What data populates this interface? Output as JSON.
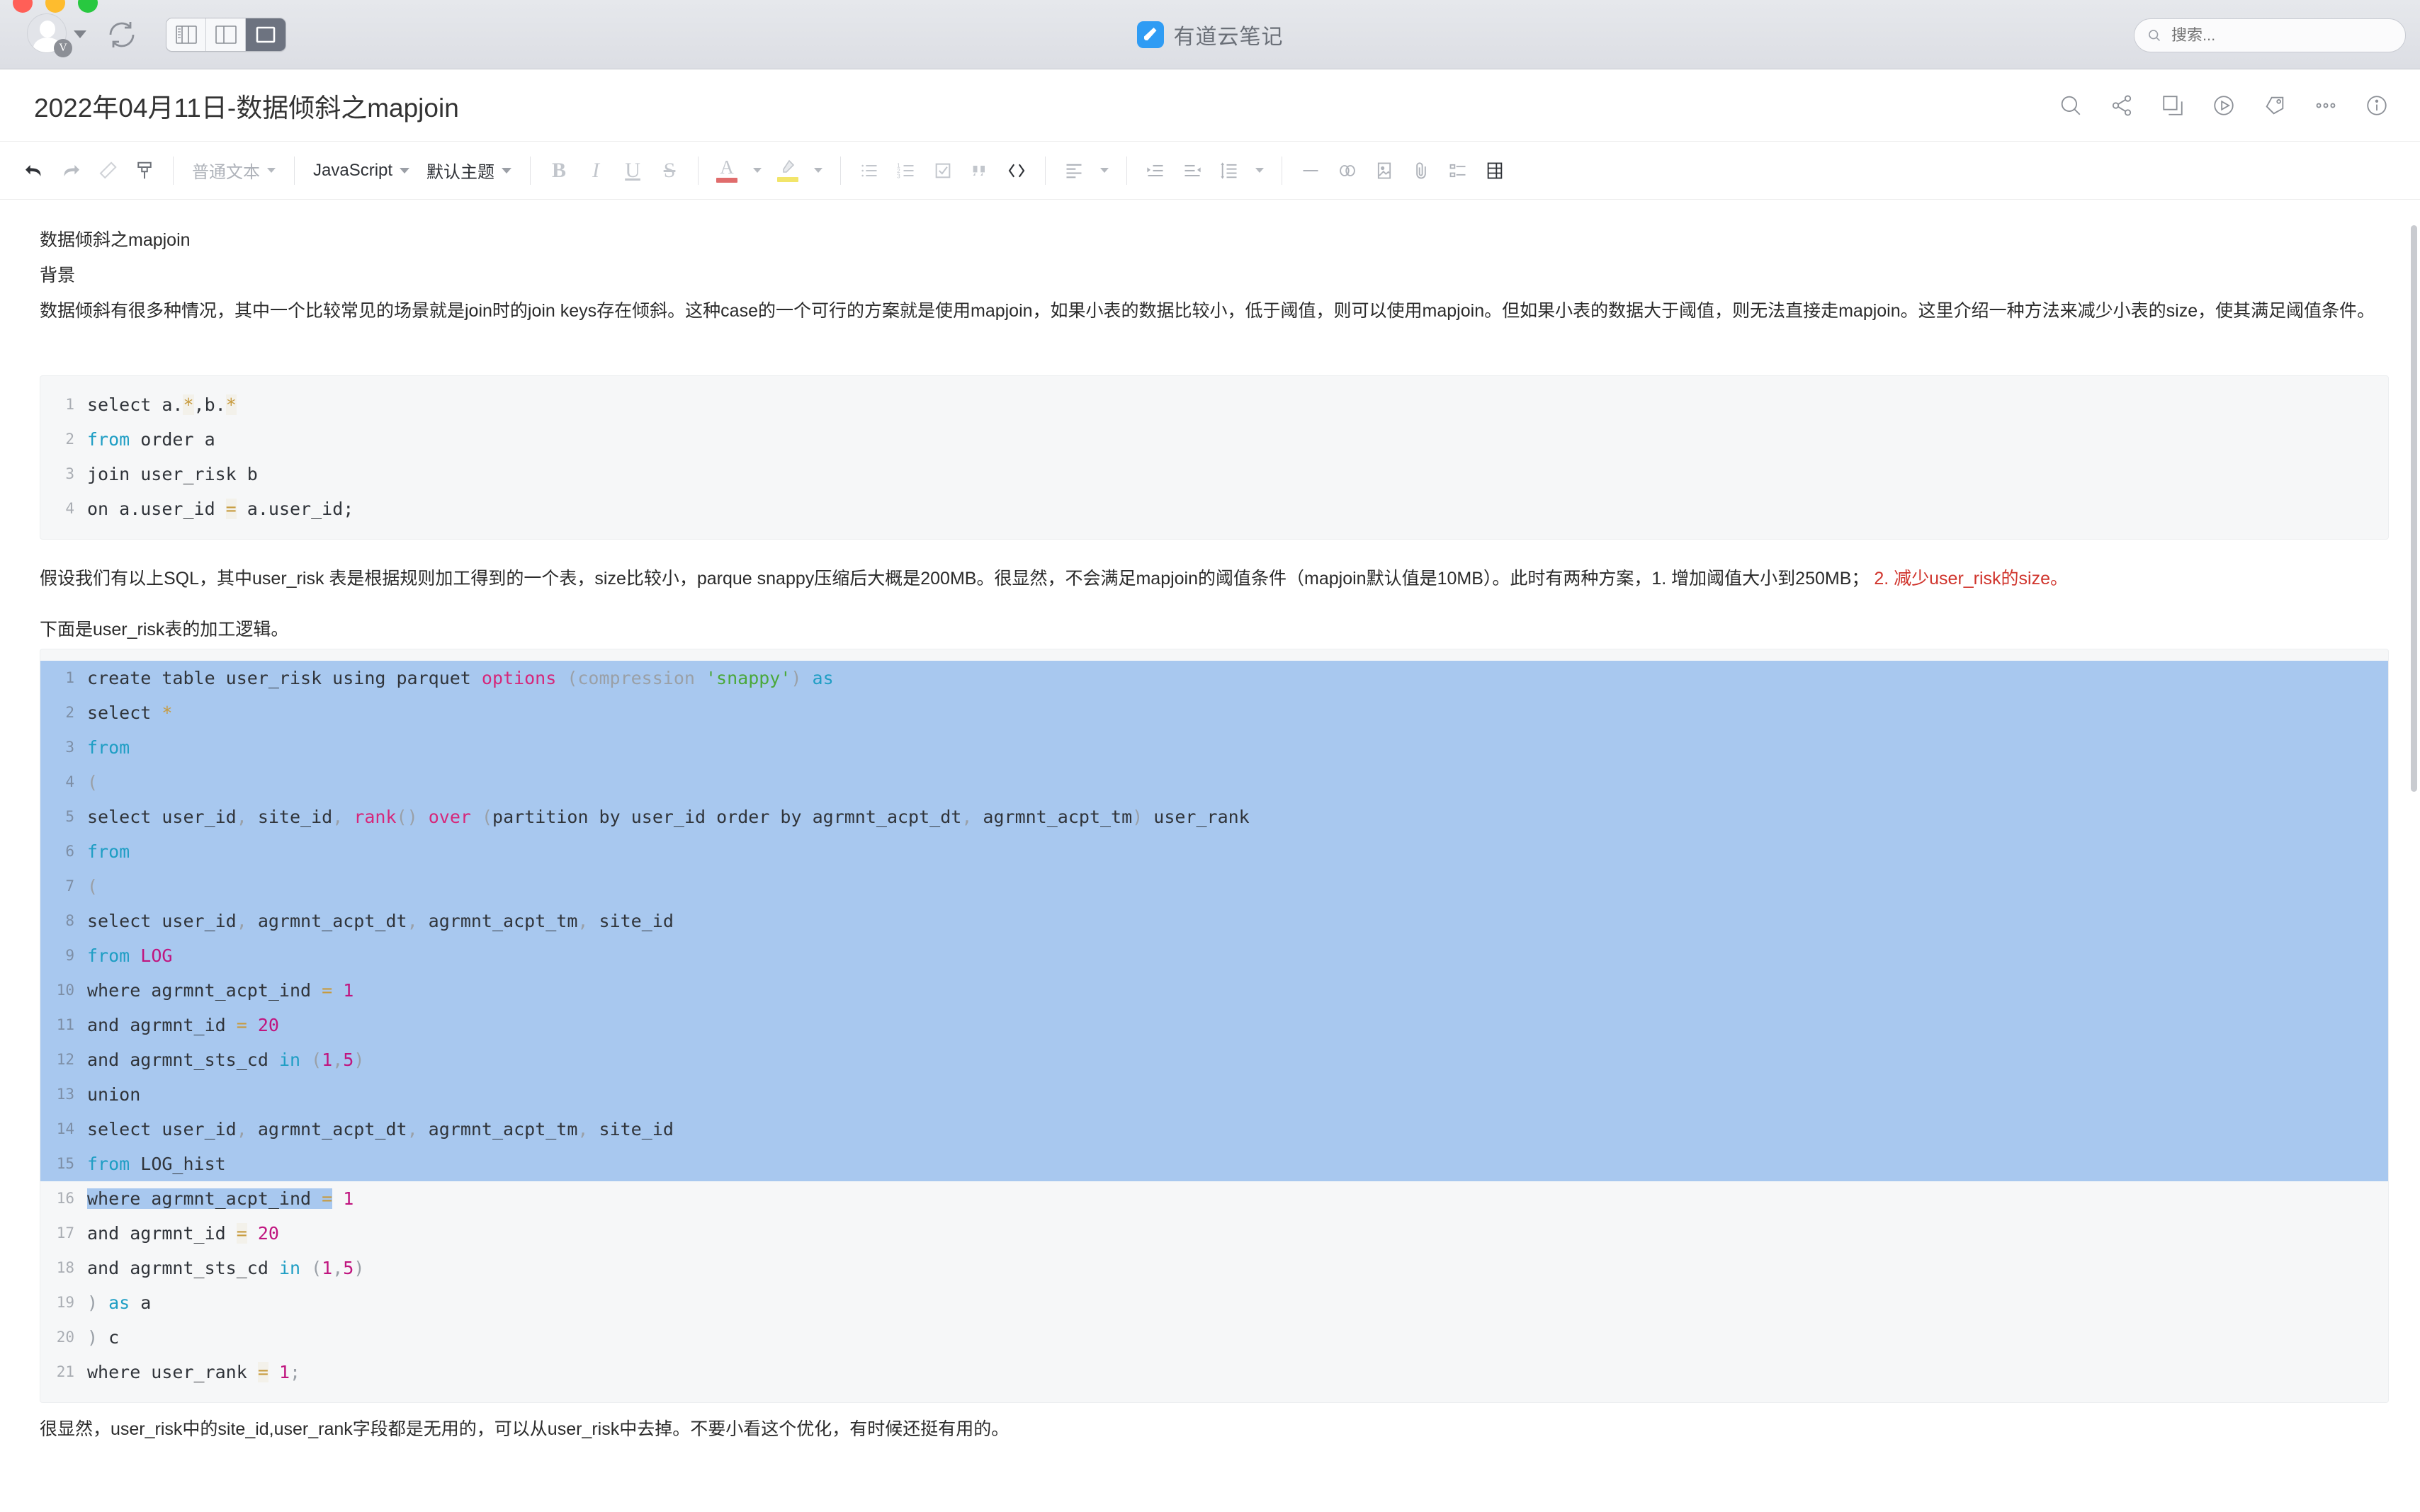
{
  "window": {
    "app_title": "有道云笔记",
    "traffic_lights": [
      "close",
      "minimize",
      "zoom"
    ],
    "account_badge": "V",
    "view_modes": [
      {
        "name": "three-pane",
        "active": false
      },
      {
        "name": "two-pane",
        "active": false
      },
      {
        "name": "single-pane",
        "active": true
      }
    ]
  },
  "search": {
    "placeholder": "搜索...",
    "value": "",
    "icon": "search-icon"
  },
  "document": {
    "title": "2022年04月11日-数据倾斜之mapjoin",
    "actions": [
      {
        "name": "search-icon",
        "label": "搜索"
      },
      {
        "name": "share-icon",
        "label": "分享"
      },
      {
        "name": "copy-icon",
        "label": "复制"
      },
      {
        "name": "present-icon",
        "label": "演示"
      },
      {
        "name": "tag-icon",
        "label": "标签"
      },
      {
        "name": "more-icon",
        "label": "更多"
      },
      {
        "name": "info-icon",
        "label": "信息"
      }
    ]
  },
  "toolbar": {
    "undo": "撤销",
    "redo": "重做",
    "eraser": "清除格式",
    "format_painter": "格式刷",
    "paragraph_style": "普通文本",
    "code_language": "JavaScript",
    "code_theme": "默认主题",
    "bold": "B",
    "italic": "I",
    "underline": "U",
    "strike": "S",
    "font_color": "A",
    "font_color_swatch": "#e06c6c",
    "highlight_swatch": "#f2e56a",
    "bullet_list": "无序列表",
    "numbered_list": "有序列表",
    "checklist": "待办",
    "quote": "引用",
    "code": "代码块",
    "align": "对齐",
    "indent": "增加缩进",
    "outdent": "减少缩进",
    "line_height": "行高",
    "divider": "分割线",
    "link": "链接",
    "image": "图片",
    "attachment": "附件",
    "outline": "目录",
    "table": "表格"
  },
  "content": {
    "heading": "数据倾斜之mapjoin",
    "subheading": "背景",
    "para1": "数据倾斜有很多种情况，其中一个比较常见的场景就是join时的join keys存在倾斜。这种case的一个可行的方案就是使用mapjoin，如果小表的数据比较小，低于阈值，则可以使用mapjoin。但如果小表的数据大于阈值，则无法直接走mapjoin。这里介绍一种方法来减少小表的size，使其满足阈值条件。",
    "para2_black": "假设我们有以上SQL，其中user_risk 表是根据规则加工得到的一个表，size比较小，parque snappy压缩后大概是200MB。很显然，不会满足mapjoin的阈值条件（mapjoin默认值是10MB）。此时有两种方案，1. 增加阈值大小到250MB；",
    "para2_red": "2. 减少user_risk的size。",
    "para3": "下面是user_risk表的加工逻辑。",
    "para4": "很显然，user_risk中的site_id,user_rank字段都是无用的，可以从user_risk中去掉。不要小看这个优化，有时候还挺有用的。"
  },
  "code_block_1": {
    "language": "sql",
    "selected": false,
    "lines": [
      {
        "n": "1",
        "tokens": [
          {
            "t": "select a.",
            "c": "plain"
          },
          {
            "t": "*",
            "c": "amber"
          },
          {
            "t": ",b.",
            "c": "plain"
          },
          {
            "t": "*",
            "c": "amber"
          }
        ]
      },
      {
        "n": "2",
        "tokens": [
          {
            "t": "from",
            "c": "cyan"
          },
          {
            "t": " order a",
            "c": "plain"
          }
        ]
      },
      {
        "n": "3",
        "tokens": [
          {
            "t": "join user_risk b",
            "c": "plain"
          }
        ]
      },
      {
        "n": "4",
        "tokens": [
          {
            "t": "on a.user_id ",
            "c": "plain"
          },
          {
            "t": "=",
            "c": "amber"
          },
          {
            "t": " a.user_id;",
            "c": "plain"
          }
        ]
      }
    ]
  },
  "code_block_2": {
    "language": "sql",
    "selected": true,
    "selection_ends_at_line": "16",
    "lines": [
      {
        "n": "1",
        "hl": true,
        "tokens": [
          {
            "t": "create table user_risk using parquet ",
            "c": "plain"
          },
          {
            "t": "options",
            "c": "pink"
          },
          {
            "t": " (compression ",
            "c": "gray"
          },
          {
            "t": "'snappy'",
            "c": "green"
          },
          {
            "t": ")",
            "c": "gray"
          },
          {
            "t": " as",
            "c": "cyan"
          }
        ]
      },
      {
        "n": "2",
        "hl": true,
        "tokens": [
          {
            "t": "select ",
            "c": "plain"
          },
          {
            "t": "*",
            "c": "amber2"
          }
        ]
      },
      {
        "n": "3",
        "hl": true,
        "tokens": [
          {
            "t": "from",
            "c": "cyan"
          }
        ]
      },
      {
        "n": "4",
        "hl": true,
        "tokens": [
          {
            "t": "(",
            "c": "gray"
          }
        ]
      },
      {
        "n": "5",
        "hl": true,
        "tokens": [
          {
            "t": "select user_id",
            "c": "plain"
          },
          {
            "t": ",",
            "c": "gray"
          },
          {
            "t": " site_id",
            "c": "plain"
          },
          {
            "t": ",",
            "c": "gray"
          },
          {
            "t": " ",
            "c": "plain"
          },
          {
            "t": "rank",
            "c": "pink"
          },
          {
            "t": "()",
            "c": "gray"
          },
          {
            "t": " ",
            "c": "plain"
          },
          {
            "t": "over",
            "c": "pink"
          },
          {
            "t": " (",
            "c": "gray"
          },
          {
            "t": "partition by user_id order by agrmnt_acpt_dt",
            "c": "plain"
          },
          {
            "t": ",",
            "c": "gray"
          },
          {
            "t": " agrmnt_acpt_tm",
            "c": "plain"
          },
          {
            "t": ")",
            "c": "gray"
          },
          {
            "t": " user_rank",
            "c": "plain"
          }
        ]
      },
      {
        "n": "6",
        "hl": true,
        "tokens": [
          {
            "t": "from",
            "c": "cyan"
          }
        ]
      },
      {
        "n": "7",
        "hl": true,
        "tokens": [
          {
            "t": "(",
            "c": "gray"
          }
        ]
      },
      {
        "n": "8",
        "hl": true,
        "tokens": [
          {
            "t": "select user_id",
            "c": "plain"
          },
          {
            "t": ",",
            "c": "gray"
          },
          {
            "t": " agrmnt_acpt_dt",
            "c": "plain"
          },
          {
            "t": ",",
            "c": "gray"
          },
          {
            "t": " agrmnt_acpt_tm",
            "c": "plain"
          },
          {
            "t": ",",
            "c": "gray"
          },
          {
            "t": " site_id",
            "c": "plain"
          }
        ]
      },
      {
        "n": "9",
        "hl": true,
        "tokens": [
          {
            "t": "from",
            "c": "cyan"
          },
          {
            "t": " ",
            "c": "plain"
          },
          {
            "t": "LOG",
            "c": "num"
          }
        ]
      },
      {
        "n": "10",
        "hl": true,
        "tokens": [
          {
            "t": "where agrmnt_acpt_ind ",
            "c": "plain"
          },
          {
            "t": "=",
            "c": "amber2"
          },
          {
            "t": " ",
            "c": "plain"
          },
          {
            "t": "1",
            "c": "num"
          }
        ]
      },
      {
        "n": "11",
        "hl": true,
        "tokens": [
          {
            "t": "and agrmnt_id ",
            "c": "plain"
          },
          {
            "t": "=",
            "c": "amber2"
          },
          {
            "t": " ",
            "c": "plain"
          },
          {
            "t": "20",
            "c": "num"
          }
        ]
      },
      {
        "n": "12",
        "hl": true,
        "tokens": [
          {
            "t": "and agrmnt_sts_cd ",
            "c": "plain"
          },
          {
            "t": "in",
            "c": "cyan"
          },
          {
            "t": " (",
            "c": "gray"
          },
          {
            "t": "1",
            "c": "num"
          },
          {
            "t": ",",
            "c": "gray"
          },
          {
            "t": "5",
            "c": "num"
          },
          {
            "t": ")",
            "c": "gray"
          }
        ]
      },
      {
        "n": "13",
        "hl": true,
        "tokens": [
          {
            "t": "union",
            "c": "plain"
          }
        ]
      },
      {
        "n": "14",
        "hl": true,
        "tokens": [
          {
            "t": "select user_id",
            "c": "plain"
          },
          {
            "t": ",",
            "c": "gray"
          },
          {
            "t": " agrmnt_acpt_dt",
            "c": "plain"
          },
          {
            "t": ",",
            "c": "gray"
          },
          {
            "t": " agrmnt_acpt_tm",
            "c": "plain"
          },
          {
            "t": ",",
            "c": "gray"
          },
          {
            "t": " site_id",
            "c": "plain"
          }
        ]
      },
      {
        "n": "15",
        "hl": true,
        "tokens": [
          {
            "t": "from",
            "c": "cyan"
          },
          {
            "t": " LOG_hist",
            "c": "plain"
          }
        ]
      },
      {
        "n": "16",
        "hl": "partial",
        "tokens": [
          {
            "t": "where agrmnt_acpt_ind ",
            "c": "plain"
          },
          {
            "t": "=",
            "c": "amber2"
          },
          {
            "t": " ",
            "c": "plain"
          },
          {
            "t": "1",
            "c": "num"
          }
        ]
      },
      {
        "n": "17",
        "hl": false,
        "tokens": [
          {
            "t": "and agrmnt_id ",
            "c": "plain"
          },
          {
            "t": "=",
            "c": "amber"
          },
          {
            "t": " ",
            "c": "plain"
          },
          {
            "t": "20",
            "c": "num"
          }
        ]
      },
      {
        "n": "18",
        "hl": false,
        "tokens": [
          {
            "t": "and agrmnt_sts_cd ",
            "c": "plain"
          },
          {
            "t": "in",
            "c": "cyan"
          },
          {
            "t": " (",
            "c": "gray"
          },
          {
            "t": "1",
            "c": "num"
          },
          {
            "t": ",",
            "c": "gray"
          },
          {
            "t": "5",
            "c": "num"
          },
          {
            "t": ")",
            "c": "gray"
          }
        ]
      },
      {
        "n": "19",
        "hl": false,
        "tokens": [
          {
            "t": ")",
            "c": "gray"
          },
          {
            "t": " ",
            "c": "plain"
          },
          {
            "t": "as",
            "c": "cyan"
          },
          {
            "t": " a",
            "c": "plain"
          }
        ]
      },
      {
        "n": "20",
        "hl": false,
        "tokens": [
          {
            "t": ")",
            "c": "gray"
          },
          {
            "t": " c",
            "c": "plain"
          }
        ]
      },
      {
        "n": "21",
        "hl": false,
        "tokens": [
          {
            "t": "where user_rank ",
            "c": "plain"
          },
          {
            "t": "=",
            "c": "amber"
          },
          {
            "t": " ",
            "c": "plain"
          },
          {
            "t": "1",
            "c": "num"
          },
          {
            "t": ";",
            "c": "gray"
          }
        ]
      }
    ]
  }
}
